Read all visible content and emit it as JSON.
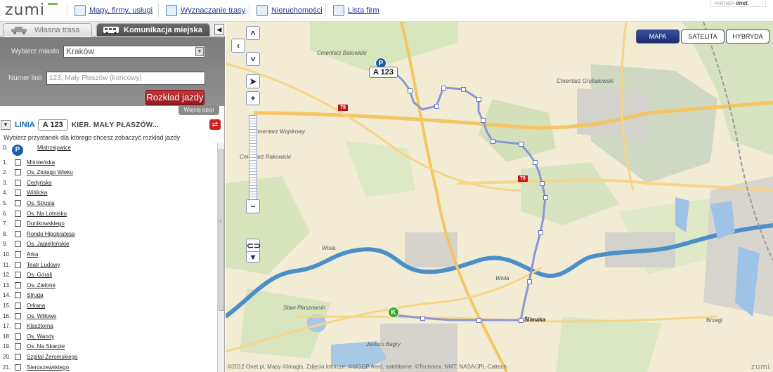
{
  "app": {
    "logo_text": "zumi"
  },
  "nav": {
    "items": [
      {
        "label": "Mapy, firmy, usługi",
        "icon": "map-icon"
      },
      {
        "label": "Wyznaczanie trasy",
        "icon": "route-icon"
      },
      {
        "label": "Nieruchomości",
        "icon": "house-icon"
      },
      {
        "label": "Lista firm",
        "icon": "list-icon"
      }
    ],
    "partner_label": "PARTNER",
    "partner_brand": "onet."
  },
  "tabs": {
    "own_route": "Własna trasa",
    "public_transport": "Komunikacja miejska"
  },
  "form": {
    "city_label": "Wybierz miasto",
    "city_value": "Kraków",
    "line_label": "Numer linii",
    "line_placeholder": "123, Mały Płaszów (końcowy)",
    "schedule_button": "Rozkład jazdy",
    "more_options": "Więcej opcji"
  },
  "line": {
    "title": "LINIA",
    "number": "A 123",
    "direction": "KIER. MAŁY PŁASZÓW...",
    "choose_stop": "Wybierz przystanek dla którego chcesz zobaczyć rozkład jazdy",
    "stops": [
      {
        "num": "0.",
        "name": "Mistrzejowice"
      },
      {
        "num": "1.",
        "name": "Miśnieńska"
      },
      {
        "num": "2.",
        "name": "Os. Złotego Wieku"
      },
      {
        "num": "3.",
        "name": "Cedyńska"
      },
      {
        "num": "4.",
        "name": "Wiślicka"
      },
      {
        "num": "5.",
        "name": "Os. Strusia"
      },
      {
        "num": "6.",
        "name": "Os. Na Lotnisku"
      },
      {
        "num": "7.",
        "name": "Dunikowskiego"
      },
      {
        "num": "8.",
        "name": "Rondo Hipokratesa"
      },
      {
        "num": "9.",
        "name": "Os. Jagiellońskie"
      },
      {
        "num": "10.",
        "name": "Arka"
      },
      {
        "num": "11.",
        "name": "Teatr Ludowy"
      },
      {
        "num": "12.",
        "name": "Os. Górali"
      },
      {
        "num": "13.",
        "name": "Os. Zielone"
      },
      {
        "num": "14.",
        "name": "Struga"
      },
      {
        "num": "15.",
        "name": "Orkana"
      },
      {
        "num": "16.",
        "name": "Os. Willowe"
      },
      {
        "num": "17.",
        "name": "Klasztorna"
      },
      {
        "num": "18.",
        "name": "Os. Wandy"
      },
      {
        "num": "19.",
        "name": "Os. Na Skarpie"
      },
      {
        "num": "20.",
        "name": "Szpital Żeromskiego"
      },
      {
        "num": "21.",
        "name": "Sieroszewskiego"
      }
    ]
  },
  "map": {
    "types": [
      "MAPA",
      "SATELITA",
      "HYBRYDA"
    ],
    "active_type": "MAPA",
    "route_label": "A 123",
    "start_marker": "P",
    "end_marker": "K",
    "labels": {
      "cm_batowicki": "Cmentarz Batowicki",
      "cm_grebalowski": "Cmentarz Grębałowski",
      "cm_wojskowy": "Cmentarz Wojskowy",
      "cm_rakowicki": "Cmentarz Rakowicki",
      "wisla1": "Wisła",
      "wisla2": "Wisła",
      "staw": "Staw Płaszowski",
      "jezioro": "Jezioro Bagry",
      "slimaka": "Ślimaka",
      "brzegi": "Brzegi"
    },
    "road_79": "79",
    "copyright": "©2012 Onet.pl, Mapy ©Imagis, Zdjęcia lotnicze: ©MGGP Aero, satelitarne: ©Techmex, NMT: NASA/JPL-Caltech",
    "watermark": "zumi"
  },
  "colors": {
    "route": "#8c96d6",
    "accent_red": "#c22b31",
    "link_blue": "#1a3d8f"
  }
}
